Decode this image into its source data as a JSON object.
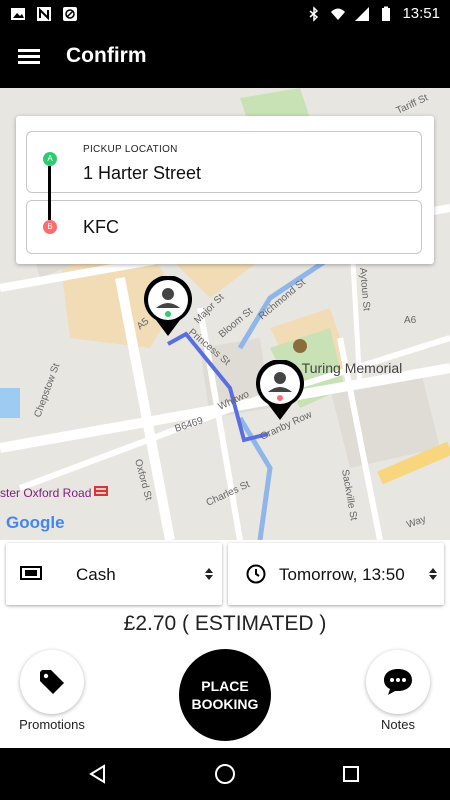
{
  "status_bar": {
    "time": "13:51",
    "icons": [
      "image-icon",
      "n-icon",
      "sync-icon",
      "bluetooth-icon",
      "wifi-icon",
      "signal-icon",
      "battery-icon"
    ]
  },
  "app_bar": {
    "title": "Confirm",
    "menu_icon": "hamburger-menu-icon"
  },
  "map": {
    "labels": {
      "alan_turing": "Alan Turing Memorial",
      "oxford_road": "ster Oxford Road",
      "princess_st": "Princess St",
      "granby_row": "Granby Row",
      "whitworth": "Whitwo",
      "charles_st": "Charles St",
      "oxford_st": "Oxford St",
      "sackville_st": "Sackville St",
      "chepstow_st": "Chepstow St",
      "b6469": "B6469",
      "bloom_st": "Bloom St",
      "major_st": "Major St",
      "richmond_st": "Richmond St",
      "aytoun_st": "Aytoun St",
      "a6": "A6",
      "tariff_st": "Tariff St",
      "a5": "A5",
      "way": "Way",
      "google": "Google"
    },
    "accent_route_color": "#5b6ee0"
  },
  "address_card": {
    "pickup_label": "PICKUP LOCATION",
    "pickup_value": "1 Harter Street",
    "pickup_marker": "A",
    "drop_value": "KFC",
    "drop_marker": "B"
  },
  "controls": {
    "payment_value": "Cash",
    "payment_icon": "cash-icon",
    "time_value": "Tomorrow, 13:50",
    "time_icon": "clock-icon"
  },
  "price_text": "£2.70 ( ESTIMATED )",
  "actions": {
    "promotions_label": "Promotions",
    "promotions_icon": "tag-icon",
    "place_booking_line1": "PLACE",
    "place_booking_line2": "BOOKING",
    "notes_label": "Notes",
    "notes_icon": "chat-bubble-icon"
  },
  "colors": {
    "pickup_green": "#2ecc71",
    "drop_red": "#ff6b6b",
    "appbar_black": "#000000"
  }
}
